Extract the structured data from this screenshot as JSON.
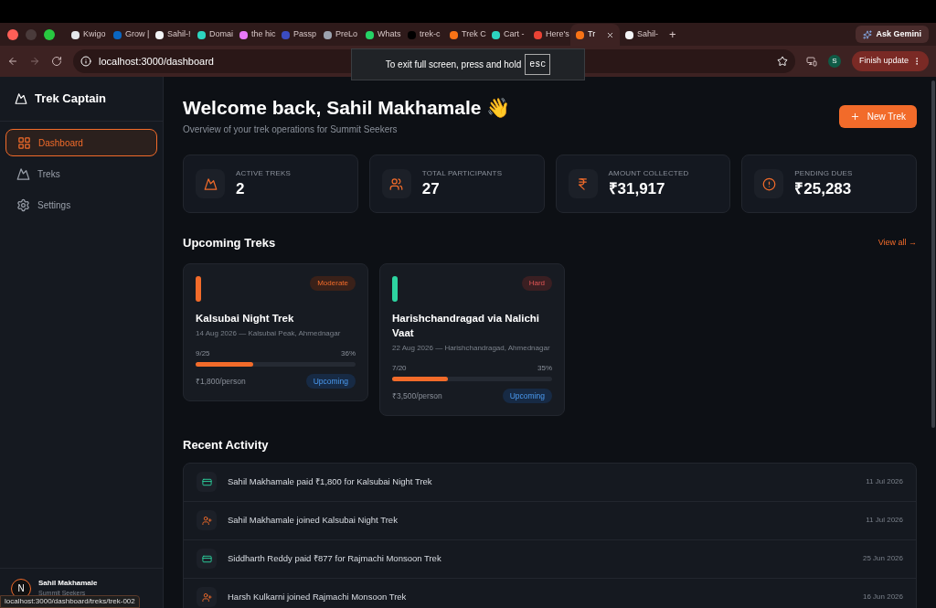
{
  "browser": {
    "tabs": [
      {
        "label": "Kwigo",
        "color": "#e5e7eb",
        "selected": false
      },
      {
        "label": "Grow |",
        "color": "#0a66c2",
        "selected": false
      },
      {
        "label": "Sahil-!",
        "color": "#f3f4f6",
        "selected": false
      },
      {
        "label": "Domai",
        "color": "#2dd4bf",
        "selected": false
      },
      {
        "label": "the hic",
        "color": "#e879f9",
        "selected": false
      },
      {
        "label": "Passp",
        "color": "#3b4cc0",
        "selected": false
      },
      {
        "label": "PreLo",
        "color": "#9ca3af",
        "selected": false
      },
      {
        "label": "Whats",
        "color": "#25d366",
        "selected": false
      },
      {
        "label": "trek-c",
        "color": "#000000",
        "selected": false
      },
      {
        "label": "Trek C",
        "color": "#f97316",
        "selected": false
      },
      {
        "label": "Cart -",
        "color": "#2dd4bf",
        "selected": false
      },
      {
        "label": "Here's",
        "color": "#ea4335",
        "selected": false
      },
      {
        "label": "Tr",
        "color": "#f97316",
        "selected": true
      },
      {
        "label": "Sahil-",
        "color": "#f3f4f6",
        "selected": false
      }
    ],
    "new_tab": "+",
    "gemini": "Ask Gemini",
    "url": "localhost:3000/dashboard",
    "profile": "S",
    "update": "Finish update",
    "toast": {
      "text": "To exit full screen, press and hold",
      "key": "esc"
    },
    "status_url": "localhost:3000/dashboard/treks/trek-002"
  },
  "sidebar": {
    "brand": "Trek Captain",
    "items": [
      {
        "label": "Dashboard",
        "kind": "dashboard",
        "selected": true
      },
      {
        "label": "Treks",
        "kind": "treks",
        "selected": false
      },
      {
        "label": "Settings",
        "kind": "settings",
        "selected": false
      }
    ],
    "user": {
      "badge": "N",
      "name": "Sahil Makhamale",
      "org": "Summit Seekers"
    }
  },
  "header": {
    "title": "Welcome back, Sahil Makhamale 👋",
    "subtitle": "Overview of your trek operations for Summit Seekers",
    "button": "New Trek"
  },
  "stats": [
    {
      "kind": "treks",
      "label": "ACTIVE TREKS",
      "value": "2"
    },
    {
      "kind": "people",
      "label": "TOTAL PARTICIPANTS",
      "value": "27"
    },
    {
      "kind": "rupee",
      "label": "AMOUNT COLLECTED",
      "value": "₹31,917"
    },
    {
      "kind": "alert",
      "label": "PENDING DUES",
      "value": "₹25,283"
    }
  ],
  "upcoming": {
    "title": "Upcoming Treks",
    "view_all": "View all →",
    "treks": [
      {
        "name": "Kalsubai Night Trek",
        "color": "#f26b2a",
        "difficulty": "Moderate",
        "kind": "moderate",
        "meta": "14 Aug 2026 — Kalsubai Peak, Ahmednagar",
        "count": "9/25",
        "percent": "36%",
        "level": 0.36,
        "price": "₹1,800/person",
        "status": "Upcoming"
      },
      {
        "name": "Harishchandragad via Nalichi Vaat",
        "color": "#2dd4a0",
        "difficulty": "Hard",
        "kind": "hard",
        "meta": "22 Aug 2026 — Harishchandragad, Ahmednagar",
        "count": "7/20",
        "percent": "35%",
        "level": 0.35,
        "price": "₹3,500/person",
        "status": "Upcoming"
      }
    ]
  },
  "activity": {
    "title": "Recent Activity",
    "items": [
      {
        "kind": "payment",
        "text": "Sahil Makhamale paid ₹1,800 for Kalsubai Night Trek",
        "date": "11 Jul 2026"
      },
      {
        "kind": "join",
        "text": "Sahil Makhamale joined Kalsubai Night Trek",
        "date": "11 Jul 2026"
      },
      {
        "kind": "payment",
        "text": "Siddharth Reddy paid ₹877 for Rajmachi Monsoon Trek",
        "date": "25 Jun 2026"
      },
      {
        "kind": "join",
        "text": "Harsh Kulkarni joined Rajmachi Monsoon Trek",
        "date": "16 Jun 2026"
      }
    ]
  }
}
